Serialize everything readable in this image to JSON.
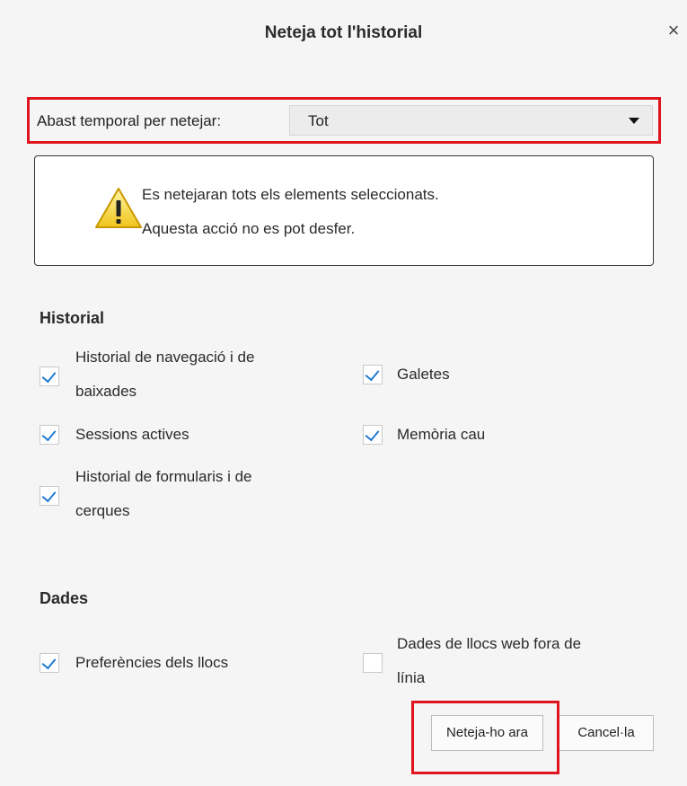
{
  "dialog": {
    "title": "Neteja tot l'historial",
    "close_symbol": "×"
  },
  "time_range": {
    "label": "Abast temporal per netejar:",
    "selected": "Tot",
    "highlight_color": "#e0141f"
  },
  "warning": {
    "icon": "warning-triangle-icon",
    "line1": "Es netejaran tots els elements seleccionats.",
    "line2": "Aquesta acció no es pot desfer."
  },
  "history_section": {
    "title": "Historial",
    "items": [
      {
        "label_line1": "Historial de navegació i de",
        "label_line2": "baixades",
        "checked": true
      },
      {
        "label_line1": "Galetes",
        "checked": true
      },
      {
        "label_line1": "Sessions actives",
        "checked": true
      },
      {
        "label_line1": "Memòria cau",
        "checked": true
      },
      {
        "label_line1": "Historial de formularis i de",
        "label_line2": "cerques",
        "checked": true
      }
    ]
  },
  "data_section": {
    "title": "Dades",
    "items": [
      {
        "label_line1": "Preferències dels llocs",
        "checked": true
      },
      {
        "label_line1": "Dades de llocs web fora de",
        "label_line2": "línia",
        "checked": false
      }
    ]
  },
  "buttons": {
    "clear_now": "Neteja-ho ara",
    "cancel": "Cancel·la"
  },
  "colors": {
    "checkmark": "#1f7ad1",
    "annotation_red": "#e0141f"
  }
}
